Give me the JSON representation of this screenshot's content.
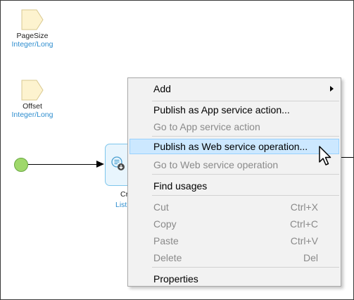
{
  "parameters": [
    {
      "name": "PageSize",
      "type": "Integer/Long",
      "icon": "parameter-icon"
    },
    {
      "name": "Offset",
      "type": "Integer/Long",
      "icon": "parameter-icon"
    }
  ],
  "activity": {
    "label": "Cr",
    "type": "List",
    "icon": "create-list-icon"
  },
  "colors": {
    "parameter_fill": "#fdf3cf",
    "activity_border": "#7ec6ec",
    "start_fill": "#9fd86b",
    "type_text": "#2f8ecf",
    "highlight": "#cce8ff"
  },
  "context_menu": {
    "items": [
      {
        "label": "Add",
        "shortcut": "",
        "disabled": false,
        "submenu": true
      },
      {
        "label": "Publish as App service action...",
        "shortcut": "",
        "disabled": false
      },
      {
        "label": "Go to App service action",
        "shortcut": "",
        "disabled": true
      },
      {
        "label": "Publish as Web service operation...",
        "shortcut": "",
        "disabled": false,
        "highlighted": true
      },
      {
        "label": "Go to Web service operation",
        "shortcut": "",
        "disabled": true
      },
      {
        "label": "Find usages",
        "shortcut": "",
        "disabled": false
      },
      {
        "label": "Cut",
        "shortcut": "Ctrl+X",
        "disabled": true
      },
      {
        "label": "Copy",
        "shortcut": "Ctrl+C",
        "disabled": true
      },
      {
        "label": "Paste",
        "shortcut": "Ctrl+V",
        "disabled": true
      },
      {
        "label": "Delete",
        "shortcut": "Del",
        "disabled": true
      },
      {
        "label": "Properties",
        "shortcut": "",
        "disabled": false
      }
    ]
  }
}
